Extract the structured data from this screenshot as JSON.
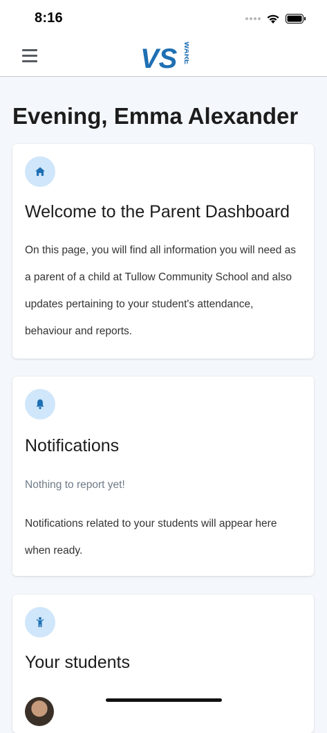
{
  "status_bar": {
    "time": "8:16"
  },
  "navbar": {
    "logo_text_main": "VS",
    "logo_text_side": "WARE"
  },
  "greeting": "Evening, Emma Alexander",
  "welcome_card": {
    "icon": "home-icon",
    "title": "Welcome to the Parent Dashboard",
    "body": "On this page, you will find all information you will need as a parent of a child at Tullow Community School and also updates pertaining to your student's attendance, behaviour and reports."
  },
  "notifications_card": {
    "icon": "bell-icon",
    "title": "Notifications",
    "empty_message": "Nothing to report yet!",
    "description": "Notifications related to your students will appear here when ready."
  },
  "students_card": {
    "icon": "child-icon",
    "title": "Your students"
  },
  "colors": {
    "accent": "#1f6fb3",
    "badge_bg": "#cfe6fb",
    "page_bg": "#f4f7fb"
  }
}
